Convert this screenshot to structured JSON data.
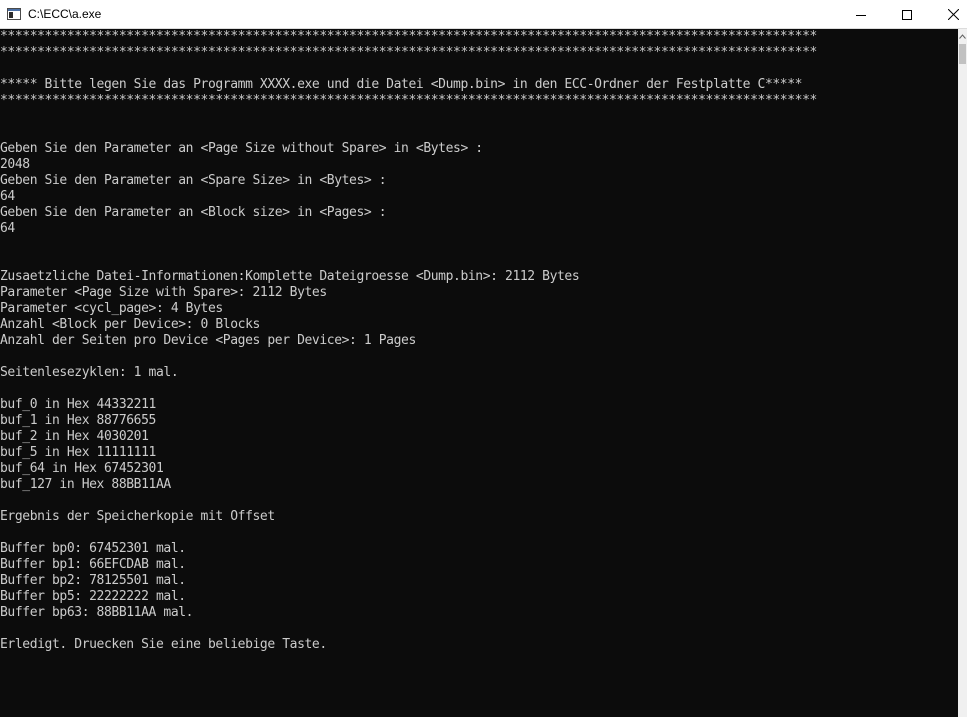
{
  "window": {
    "title": "C:\\ECC\\a.exe",
    "controls": {
      "minimize_icon": "minimize-icon",
      "maximize_icon": "maximize-icon",
      "close_icon": "close-icon"
    }
  },
  "colors": {
    "console_background": "#0c0c0c",
    "console_text": "#cccccc",
    "titlebar_background": "#ffffff"
  },
  "console": {
    "lines": [
      "**************************************************************************************************************",
      "**************************************************************************************************************",
      "",
      "***** Bitte legen Sie das Programm XXXX.exe und die Datei <Dump.bin> in den ECC-Ordner der Festplatte C*****",
      "**************************************************************************************************************",
      "",
      "",
      "Geben Sie den Parameter an <Page Size without Spare> in <Bytes> :",
      "2048",
      "Geben Sie den Parameter an <Spare Size> in <Bytes> :",
      "64",
      "Geben Sie den Parameter an <Block size> in <Pages> :",
      "64",
      "",
      "",
      "Zusaetzliche Datei-Informationen:Komplette Dateigroesse <Dump.bin>: 2112 Bytes",
      "Parameter <Page Size with Spare>: 2112 Bytes",
      "Parameter <cycl_page>: 4 Bytes",
      "Anzahl <Block per Device>: 0 Blocks",
      "Anzahl der Seiten pro Device <Pages per Device>: 1 Pages",
      "",
      "Seitenlesezyklen: 1 mal.",
      "",
      "buf_0 in Hex 44332211",
      "buf_1 in Hex 88776655",
      "buf_2 in Hex 4030201",
      "buf_5 in Hex 11111111",
      "buf_64 in Hex 67452301",
      "buf_127 in Hex 88BB11AA",
      "",
      "Ergebnis der Speicherkopie mit Offset",
      "",
      "Buffer bp0: 67452301 mal.",
      "Buffer bp1: 66EFCDAB mal.",
      "Buffer bp2: 78125501 mal.",
      "Buffer bp5: 22222222 mal.",
      "Buffer bp63: 88BB11AA mal.",
      "",
      "Erledigt. Druecken Sie eine beliebige Taste."
    ]
  }
}
